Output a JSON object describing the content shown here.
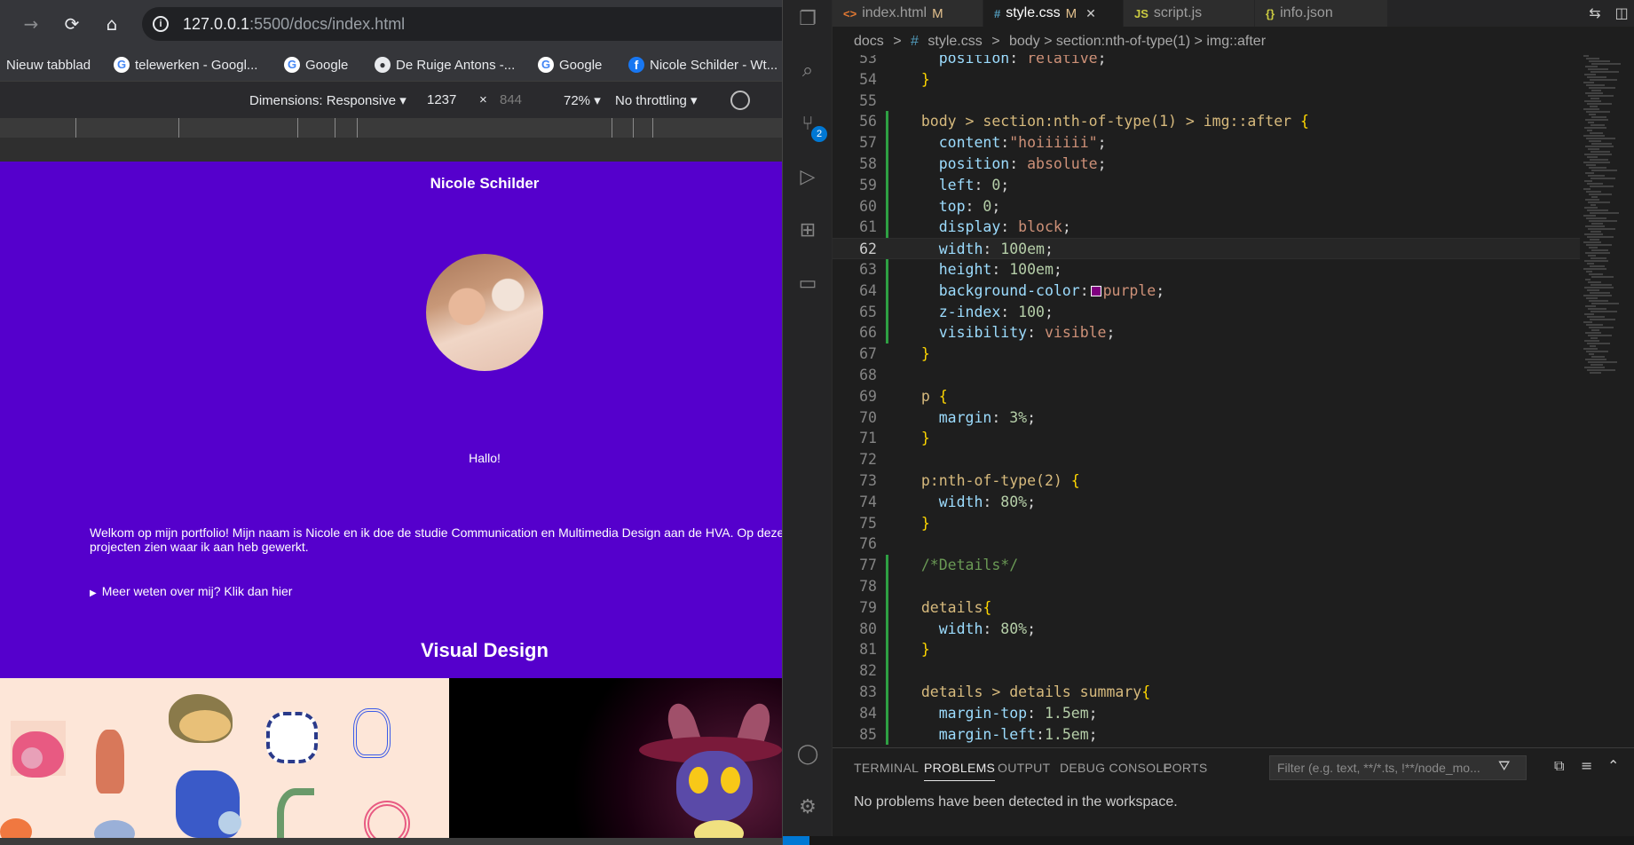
{
  "browser": {
    "nav": {
      "back": "←",
      "forward": "→",
      "reload": "⟳",
      "home": "⌂"
    },
    "url_host": "127.0.0.1",
    "url_rest": ":5500/docs/index.html",
    "bookmarks": [
      {
        "label": "Nieuw tabblad",
        "icon": ""
      },
      {
        "label": "telewerken - Googl...",
        "icon": "G"
      },
      {
        "label": "Google",
        "icon": "G"
      },
      {
        "label": "De Ruige Antons -...",
        "icon": "●"
      },
      {
        "label": "Google",
        "icon": "G"
      },
      {
        "label": "Nicole Schilder - Wt...",
        "icon": "f"
      }
    ],
    "devtools": {
      "dimensions": "Dimensions: Responsive ▾",
      "width": "1237",
      "times": "×",
      "height": "844",
      "zoom": "72% ▾",
      "throttling": "No throttling ▾"
    },
    "page": {
      "name": "Nicole Schilder",
      "hello": "Hallo!",
      "intro": "Welkom op mijn portfolio! Mijn naam is Nicole en ik doe de studie Communication en Multimedia Design aan de HVA. Op deze pagina kun je een aantal projecten zien waar ik aan heb gewerkt.",
      "details_summary": "Meer weten over mij? Klik dan hier",
      "section_title": "Visual Design"
    }
  },
  "vscode": {
    "tabs": [
      {
        "icon": "<>",
        "label": "index.html",
        "modified": "M",
        "active": false
      },
      {
        "icon": "#",
        "label": "style.css",
        "modified": "M",
        "active": true,
        "close": "✕"
      },
      {
        "icon": "JS",
        "label": "script.js",
        "modified": "",
        "active": false
      },
      {
        "icon": "{}",
        "label": "info.json",
        "modified": "",
        "active": false
      }
    ],
    "breadcrumbs": [
      "docs",
      ">",
      "#",
      "style.css",
      ">",
      "body > section:nth-of-type(1) > img::after"
    ],
    "activity": {
      "badge": "2"
    },
    "code": [
      {
        "n": "53",
        "tokens": [
          [
            "prop",
            "    position"
          ],
          [
            "op",
            ": "
          ],
          [
            "val",
            "relative"
          ],
          [
            "op",
            ";"
          ]
        ]
      },
      {
        "n": "54",
        "tokens": [
          [
            "brace",
            "  }"
          ]
        ]
      },
      {
        "n": "55",
        "tokens": []
      },
      {
        "n": "56",
        "tokens": [
          [
            "sel",
            "  body > section:nth-of-type(1) > img::after "
          ],
          [
            "brace",
            "{"
          ]
        ]
      },
      {
        "n": "57",
        "tokens": [
          [
            "prop",
            "    content"
          ],
          [
            "op",
            ":"
          ],
          [
            "val",
            "\"hoiiiiii\""
          ],
          [
            "op",
            ";"
          ]
        ]
      },
      {
        "n": "58",
        "tokens": [
          [
            "prop",
            "    position"
          ],
          [
            "op",
            ": "
          ],
          [
            "val",
            "absolute"
          ],
          [
            "op",
            ";"
          ]
        ]
      },
      {
        "n": "59",
        "tokens": [
          [
            "prop",
            "    left"
          ],
          [
            "op",
            ": "
          ],
          [
            "num",
            "0"
          ],
          [
            "op",
            ";"
          ]
        ]
      },
      {
        "n": "60",
        "tokens": [
          [
            "prop",
            "    top"
          ],
          [
            "op",
            ": "
          ],
          [
            "num",
            "0"
          ],
          [
            "op",
            ";"
          ]
        ]
      },
      {
        "n": "61",
        "tokens": [
          [
            "prop",
            "    display"
          ],
          [
            "op",
            ": "
          ],
          [
            "val",
            "block"
          ],
          [
            "op",
            ";"
          ]
        ]
      },
      {
        "n": "62",
        "tokens": [
          [
            "prop",
            "    width"
          ],
          [
            "op",
            ": "
          ],
          [
            "num",
            "100em"
          ],
          [
            "op",
            ";"
          ]
        ],
        "current": true
      },
      {
        "n": "63",
        "tokens": [
          [
            "prop",
            "    height"
          ],
          [
            "op",
            ": "
          ],
          [
            "num",
            "100em"
          ],
          [
            "op",
            ";"
          ]
        ]
      },
      {
        "n": "64",
        "tokens": [
          [
            "prop",
            "    background-color"
          ],
          [
            "op",
            ":"
          ],
          [
            "swatch",
            ""
          ],
          [
            "val",
            "purple"
          ],
          [
            "op",
            ";"
          ]
        ]
      },
      {
        "n": "65",
        "tokens": [
          [
            "prop",
            "    z-index"
          ],
          [
            "op",
            ": "
          ],
          [
            "num",
            "100"
          ],
          [
            "op",
            ";"
          ]
        ]
      },
      {
        "n": "66",
        "tokens": [
          [
            "prop",
            "    visibility"
          ],
          [
            "op",
            ": "
          ],
          [
            "val",
            "visible"
          ],
          [
            "op",
            ";"
          ]
        ]
      },
      {
        "n": "67",
        "tokens": [
          [
            "brace",
            "  }"
          ]
        ]
      },
      {
        "n": "68",
        "tokens": []
      },
      {
        "n": "69",
        "tokens": [
          [
            "sel",
            "  p "
          ],
          [
            "brace",
            "{"
          ]
        ]
      },
      {
        "n": "70",
        "tokens": [
          [
            "prop",
            "    margin"
          ],
          [
            "op",
            ": "
          ],
          [
            "num",
            "3%"
          ],
          [
            "op",
            ";"
          ]
        ]
      },
      {
        "n": "71",
        "tokens": [
          [
            "brace",
            "  }"
          ]
        ]
      },
      {
        "n": "72",
        "tokens": []
      },
      {
        "n": "73",
        "tokens": [
          [
            "sel",
            "  p:nth-of-type(2) "
          ],
          [
            "brace",
            "{"
          ]
        ]
      },
      {
        "n": "74",
        "tokens": [
          [
            "prop",
            "    width"
          ],
          [
            "op",
            ": "
          ],
          [
            "num",
            "80%"
          ],
          [
            "op",
            ";"
          ]
        ]
      },
      {
        "n": "75",
        "tokens": [
          [
            "brace",
            "  }"
          ]
        ]
      },
      {
        "n": "76",
        "tokens": []
      },
      {
        "n": "77",
        "tokens": [
          [
            "comment",
            "  /*Details*/"
          ]
        ]
      },
      {
        "n": "78",
        "tokens": []
      },
      {
        "n": "79",
        "tokens": [
          [
            "sel",
            "  details"
          ],
          [
            "brace",
            "{"
          ]
        ]
      },
      {
        "n": "80",
        "tokens": [
          [
            "prop",
            "    width"
          ],
          [
            "op",
            ": "
          ],
          [
            "num",
            "80%"
          ],
          [
            "op",
            ";"
          ]
        ]
      },
      {
        "n": "81",
        "tokens": [
          [
            "brace",
            "  }"
          ]
        ]
      },
      {
        "n": "82",
        "tokens": []
      },
      {
        "n": "83",
        "tokens": [
          [
            "sel",
            "  details > details summary"
          ],
          [
            "brace",
            "{"
          ]
        ]
      },
      {
        "n": "84",
        "tokens": [
          [
            "prop",
            "    margin-top"
          ],
          [
            "op",
            ": "
          ],
          [
            "num",
            "1.5em"
          ],
          [
            "op",
            ";"
          ]
        ]
      },
      {
        "n": "85",
        "tokens": [
          [
            "prop",
            "    margin-left"
          ],
          [
            "op",
            ":"
          ],
          [
            "num",
            "1.5em"
          ],
          [
            "op",
            ";"
          ]
        ]
      }
    ],
    "panel": {
      "tabs": [
        "TERMINAL",
        "PROBLEMS",
        "OUTPUT",
        "DEBUG CONSOLE",
        "PORTS"
      ],
      "active_tab": "PROBLEMS",
      "filter_placeholder": "Filter (e.g. text, **/*.ts, !**/node_mo...",
      "message": "No problems have been detected in the workspace."
    }
  }
}
